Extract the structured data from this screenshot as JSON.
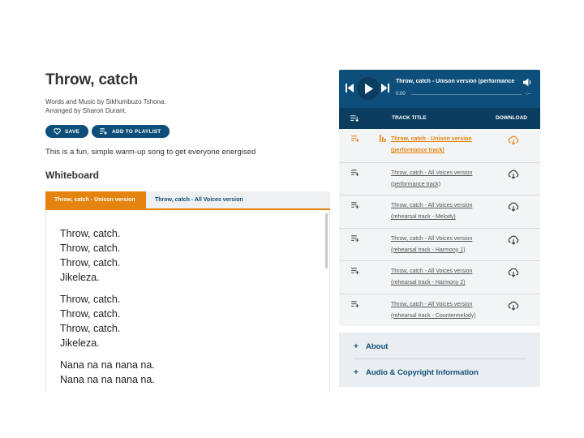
{
  "song": {
    "title": "Throw, catch",
    "credit_line1": "Words and Music by Sikhumbuzo Tshona.",
    "credit_line2": "Arranged by Sharon Durant.",
    "save_label": "SAVE",
    "add_playlist_label": "ADD TO PLAYLIST",
    "intro": "This is a fun, simple warm-up song to get everyone energised"
  },
  "whiteboard": {
    "heading": "Whiteboard",
    "tabs": [
      {
        "label": "Throw, catch - Unison version",
        "active": true
      },
      {
        "label": "Throw, catch - All Voices version",
        "active": false
      }
    ],
    "stanzas": [
      [
        "Throw, catch.",
        "Throw, catch.",
        "Throw, catch.",
        "Jikeleza."
      ],
      [
        "Throw, catch.",
        "Throw, catch.",
        "Throw, catch.",
        "Jikeleza."
      ],
      [
        "Nana na na nana na.",
        "Nana na na nana na."
      ]
    ]
  },
  "player": {
    "now_playing": "Throw, catch - Unison version (performance track)",
    "time_current": "0:00",
    "time_remaining": "-:--",
    "progress": 0
  },
  "tracks": {
    "header_title": "TRACK TITLE",
    "header_download": "DOWNLOAD",
    "items": [
      {
        "line1": "Throw, catch - Unison version",
        "line2": "(performance track)",
        "current": true
      },
      {
        "line1": "Throw, catch - All Voices version",
        "line2": "(performance track)",
        "current": false
      },
      {
        "line1": "Throw, catch - All Voices version",
        "line2": "(rehearsal track - Melody)",
        "current": false
      },
      {
        "line1": "Throw, catch - All Voices version",
        "line2": "(rehearsal track - Harmony 1)",
        "current": false
      },
      {
        "line1": "Throw, catch - All Voices version",
        "line2": "(rehearsal track - Harmony 2)",
        "current": false
      },
      {
        "line1": "Throw, catch - All Voices version",
        "line2": "(rehearsal track - Countermelody)",
        "current": false
      }
    ]
  },
  "accordion": {
    "items": [
      {
        "label": "About"
      },
      {
        "label": "Audio & Copyright Information"
      }
    ]
  },
  "colors": {
    "brand_blue": "#0d4f7a",
    "brand_blue_dark": "#0a3d5f",
    "accent_orange": "#e4830f"
  }
}
